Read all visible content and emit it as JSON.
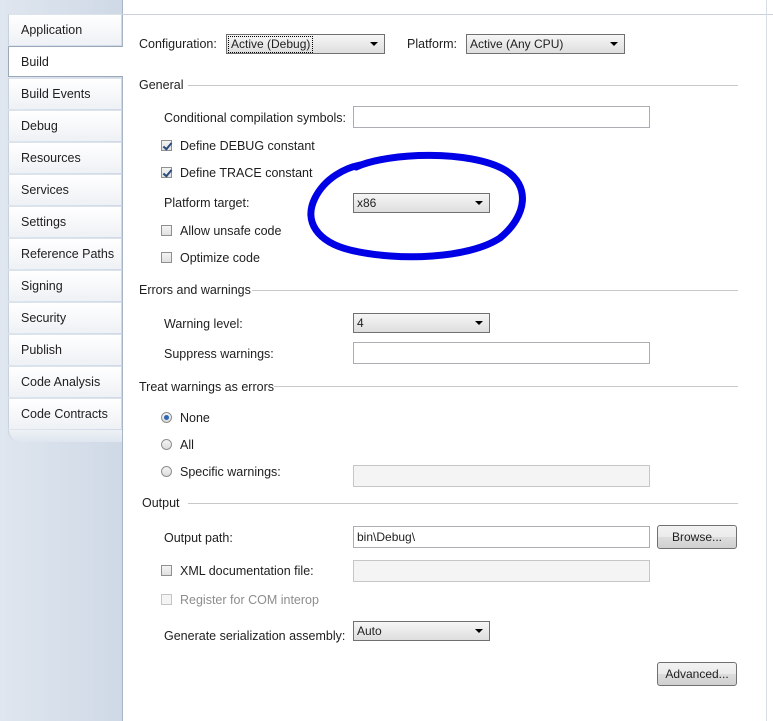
{
  "sidebar": {
    "tabs": [
      "Application",
      "Build",
      "Build Events",
      "Debug",
      "Resources",
      "Services",
      "Settings",
      "Reference Paths",
      "Signing",
      "Security",
      "Publish",
      "Code Analysis",
      "Code Contracts"
    ],
    "selected": "Build"
  },
  "header": {
    "configuration_label": "Configuration:",
    "configuration_value": "Active (Debug)",
    "platform_label": "Platform:",
    "platform_value": "Active (Any CPU)"
  },
  "general": {
    "title": "General",
    "symbols_label": "Conditional compilation symbols:",
    "symbols_value": "",
    "define_debug": "Define DEBUG constant",
    "define_debug_checked": true,
    "define_trace": "Define TRACE constant",
    "define_trace_checked": true,
    "platform_target_label": "Platform target:",
    "platform_target_value": "x86",
    "allow_unsafe": "Allow unsafe code",
    "allow_unsafe_checked": false,
    "optimize": "Optimize code",
    "optimize_checked": false
  },
  "errors": {
    "title": "Errors and warnings",
    "warning_level_label": "Warning level:",
    "warning_level_value": "4",
    "suppress_label": "Suppress warnings:",
    "suppress_value": ""
  },
  "treat": {
    "title": "Treat warnings as errors",
    "none": "None",
    "all": "All",
    "specific": "Specific warnings:",
    "selected": "None"
  },
  "output": {
    "title": "Output",
    "path_label": "Output path:",
    "path_value": "bin\\Debug\\",
    "browse": "Browse...",
    "xml_doc": "XML documentation file:",
    "register_com": "Register for COM interop",
    "serialization_label": "Generate serialization assembly:",
    "serialization_value": "Auto",
    "advanced": "Advanced..."
  },
  "colors": {
    "annotation_circle": "#0000e6"
  }
}
